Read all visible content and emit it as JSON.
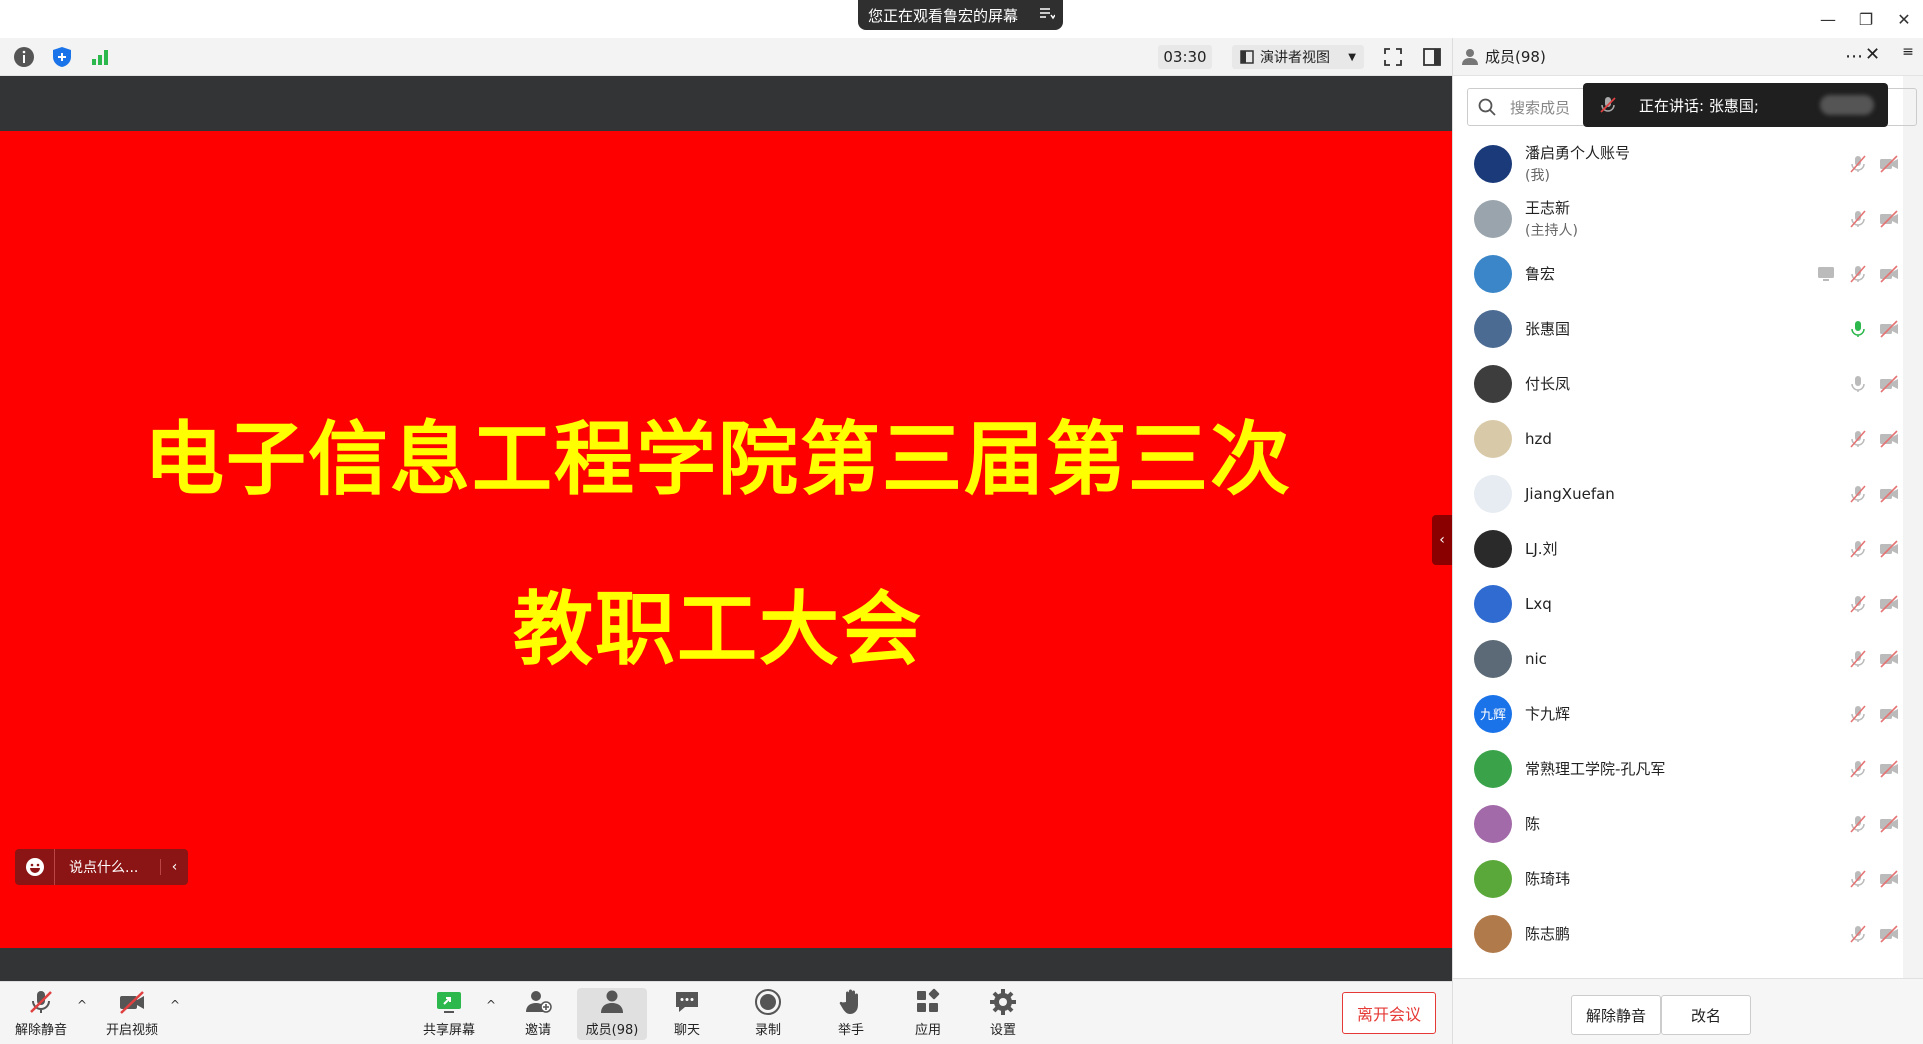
{
  "notice": {
    "text": "您正在观看鲁宏的屏幕"
  },
  "window_controls": [
    "minimize",
    "restore",
    "close"
  ],
  "infobar": {
    "timer": "03:30",
    "view_mode": "演讲者视图"
  },
  "slide": {
    "line1": "电子信息工程学院第三届第三次",
    "line2": "教职工大会",
    "background": "#fe0000",
    "text_color": "#ffff00"
  },
  "chat_input": {
    "placeholder": "说点什么..."
  },
  "bottombar": {
    "unmute": "解除静音",
    "start_video": "开启视频",
    "share_screen": "共享屏幕",
    "invite": "邀请",
    "members": "成员(98)",
    "chat": "聊天",
    "record": "录制",
    "raise_hand": "举手",
    "apps": "应用",
    "settings": "设置",
    "leave": "离开会议"
  },
  "panel": {
    "title": "成员(98)",
    "search_placeholder": "搜索成员",
    "speaking": "正在讲话: 张惠国;",
    "members": [
      {
        "name": "潘启勇个人账号",
        "sub": "(我)",
        "avatar_color": "#1b3a7a",
        "mic": "muted",
        "cam": "off"
      },
      {
        "name": "王志新",
        "sub": "(主持人)",
        "avatar_color": "#9aa4ad",
        "mic": "muted",
        "cam": "off"
      },
      {
        "name": "鲁宏",
        "sub": "",
        "avatar_color": "#3a86c8",
        "mic": "muted",
        "cam": "off",
        "sharing": true
      },
      {
        "name": "张惠国",
        "sub": "",
        "avatar_color": "#4b6b93",
        "mic": "speaking",
        "cam": "off"
      },
      {
        "name": "付长凤",
        "sub": "",
        "avatar_color": "#3d3d3d",
        "mic": "idle",
        "cam": "off"
      },
      {
        "name": "hzd",
        "sub": "",
        "avatar_color": "#d8c9a8",
        "mic": "muted",
        "cam": "off"
      },
      {
        "name": "JiangXuefan",
        "sub": "",
        "avatar_color": "#e6ecf2",
        "mic": "muted",
        "cam": "off"
      },
      {
        "name": "LJ.刘",
        "sub": "",
        "avatar_color": "#2a2a2a",
        "mic": "muted",
        "cam": "off"
      },
      {
        "name": "Lxq",
        "sub": "",
        "avatar_color": "#2f6bd0",
        "mic": "muted",
        "cam": "off"
      },
      {
        "name": "nic",
        "sub": "",
        "avatar_color": "#5b6a76",
        "mic": "muted",
        "cam": "off"
      },
      {
        "name": "卞九辉",
        "sub": "",
        "avatar_color": "#1a73e8",
        "avatar_text": "九辉",
        "mic": "muted",
        "cam": "off"
      },
      {
        "name": "常熟理工学院-孔凡军",
        "sub": "",
        "avatar_color": "#3aa34a",
        "mic": "muted",
        "cam": "off"
      },
      {
        "name": "陈",
        "sub": "",
        "avatar_color": "#a26aa8",
        "mic": "muted",
        "cam": "off"
      },
      {
        "name": "陈琦玮",
        "sub": "",
        "avatar_color": "#5aa83a",
        "mic": "muted",
        "cam": "off"
      },
      {
        "name": "陈志鹏",
        "sub": "",
        "avatar_color": "#b07a4a",
        "mic": "muted",
        "cam": "off"
      }
    ],
    "footer": {
      "unmute_all": "解除静音",
      "rename": "改名"
    }
  },
  "colors": {
    "accent_green": "#2db84d",
    "leave_red": "#e53935",
    "muted_red": "#e04040"
  }
}
